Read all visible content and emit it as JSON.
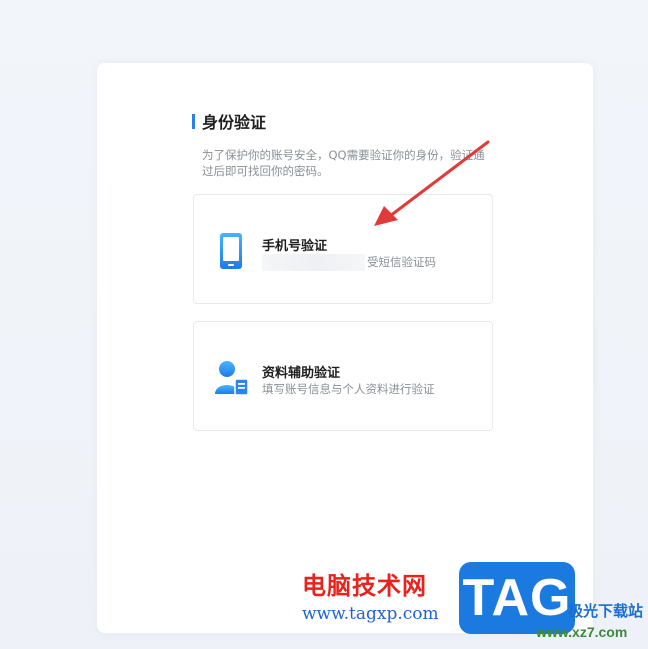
{
  "page": {
    "title": "身份验证",
    "description": "为了保护你的账号安全，QQ需要验证你的身份，验证通过后即可找回你的密码。"
  },
  "options": [
    {
      "title": "手机号验证",
      "subtitle": "受短信验证码",
      "icon": "phone-icon"
    },
    {
      "title": "资料辅助验证",
      "subtitle": "填写账号信息与个人资料进行验证",
      "icon": "user-card-icon"
    }
  ],
  "watermark": {
    "brand_cn": "电脑技术网",
    "brand_url": "www.tagxp.com",
    "logo_text": "TAG",
    "site_cn": "极光下载站",
    "site_url": "www.xz7.com"
  },
  "colors": {
    "accent": "#2a80eb",
    "arrow": "#e03b3b",
    "watermark_red": "#e8231d",
    "logo_blue": "#1b7ae0"
  }
}
